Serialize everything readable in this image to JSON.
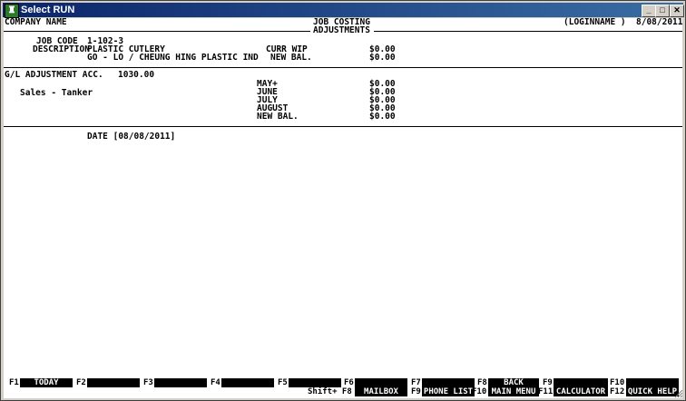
{
  "window": {
    "title": "Select RUN"
  },
  "header": {
    "company": "COMPANY NAME",
    "module": "JOB COSTING",
    "screen": "ADJUSTMENTS",
    "login": "(LOGINNAME )",
    "date": "8/08/2011"
  },
  "job": {
    "code_label": "JOB CODE",
    "code_value": "1-102-3",
    "desc_label": "DESCRIPTION",
    "desc_line1": "PLASTIC CUTLERY",
    "desc_line2": "GO - LO / CHEUNG HING PLASTIC IND",
    "curr_wip_label": "CURR WIP",
    "curr_wip_value": "$0.00",
    "new_bal_label": "NEW BAL.",
    "new_bal_value": "$0.00"
  },
  "gl": {
    "label": "G/L ADJUSTMENT ACC.",
    "acc": "1030.00",
    "name": "Sales - Tanker",
    "rows": [
      {
        "label": "MAY+",
        "value": "$0.00"
      },
      {
        "label": "JUNE",
        "value": "$0.00"
      },
      {
        "label": "JULY",
        "value": "$0.00"
      },
      {
        "label": "AUGUST",
        "value": "$0.00"
      },
      {
        "label": "NEW BAL.",
        "value": "$0.00"
      }
    ]
  },
  "date_line": "DATE [08/08/2011]",
  "fkeys": {
    "top": [
      {
        "key": "F1",
        "label": "TODAY"
      },
      {
        "key": "F2",
        "label": ""
      },
      {
        "key": "F3",
        "label": ""
      },
      {
        "key": "F4",
        "label": ""
      },
      {
        "key": "F5",
        "label": ""
      },
      {
        "key": "F6",
        "label": ""
      },
      {
        "key": "F7",
        "label": ""
      },
      {
        "key": "F8",
        "label": "BACK"
      },
      {
        "key": "F9",
        "label": ""
      },
      {
        "key": "F10",
        "label": ""
      }
    ],
    "bottom": [
      {
        "key": "Shift+ F8",
        "label": "MAILBOX"
      },
      {
        "key": "F9",
        "label": "PHONE LIST"
      },
      {
        "key": "F10",
        "label": "MAIN MENU"
      },
      {
        "key": "F11",
        "label": "CALCULATOR"
      },
      {
        "key": "F12",
        "label": "QUICK HELP"
      }
    ]
  }
}
